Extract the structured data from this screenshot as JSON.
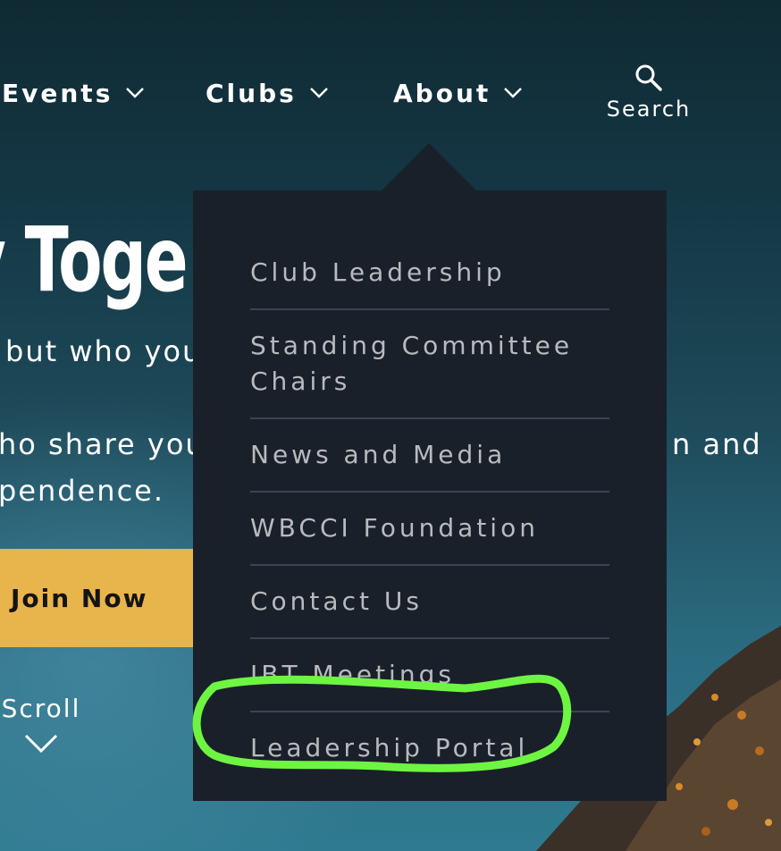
{
  "nav": {
    "items": [
      {
        "label": "Events"
      },
      {
        "label": "Clubs"
      },
      {
        "label": "About"
      }
    ],
    "search_label": "Search"
  },
  "hero": {
    "title": "y Toge",
    "line1": "but who you",
    "line2": "ho share you",
    "line2_right": "n and",
    "line3": "pendence.",
    "join_label": "Join Now",
    "scroll_label": "Scroll"
  },
  "dropdown": {
    "items": [
      {
        "label": "Club Leadership"
      },
      {
        "label": "Standing Committee Chairs"
      },
      {
        "label": "News and Media"
      },
      {
        "label": "WBCCI Foundation"
      },
      {
        "label": "Contact Us"
      },
      {
        "label": "IBT Meetings"
      },
      {
        "label": "Leadership Portal"
      }
    ]
  },
  "colors": {
    "dropdown_bg": "#1a202a",
    "accent_button": "#e8b44c",
    "annotation": "#6ef542"
  }
}
